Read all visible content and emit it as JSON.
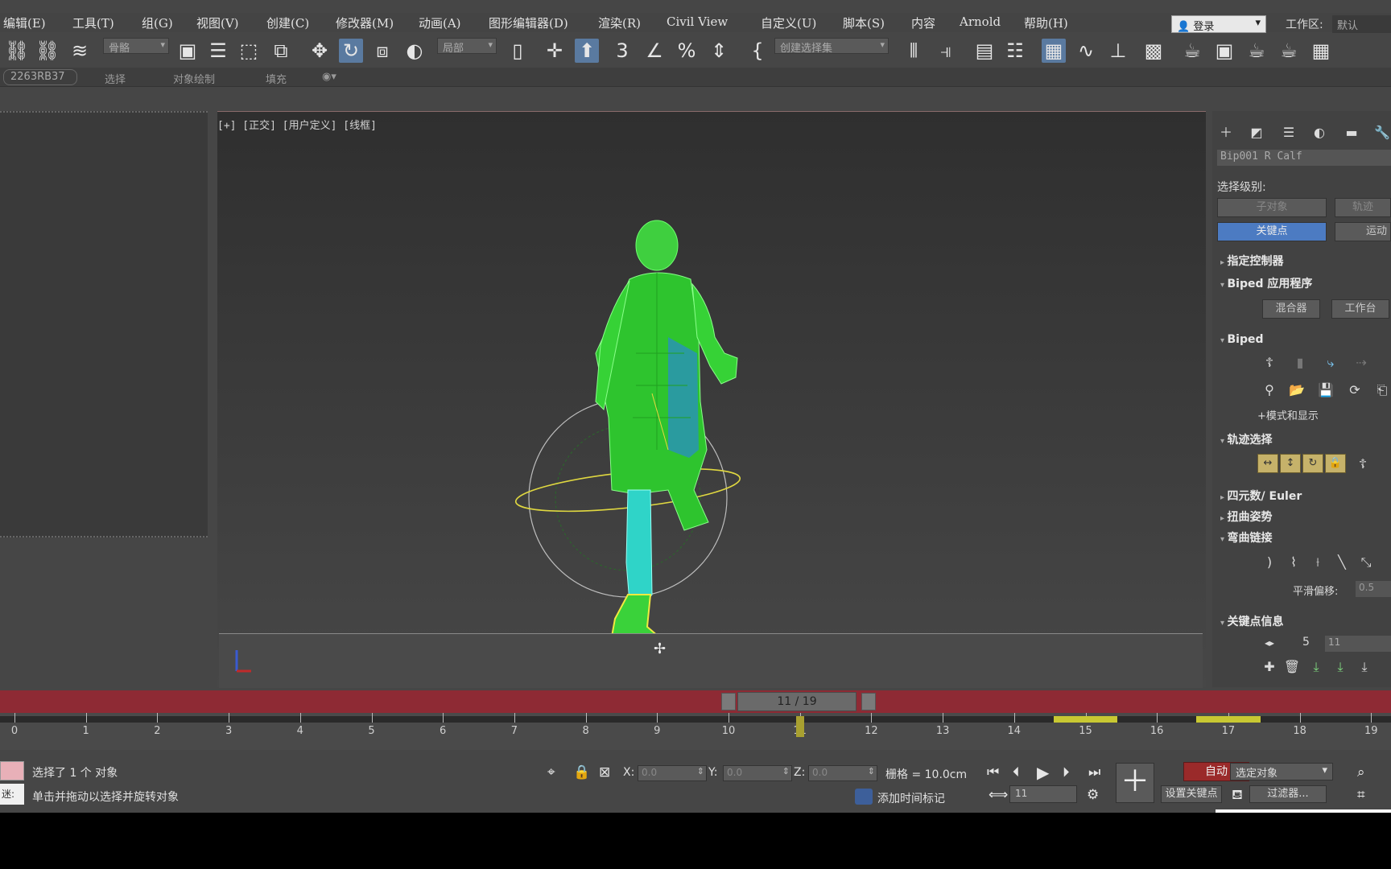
{
  "menu": [
    "编辑(E)",
    "工具(T)",
    "组(G)",
    "视图(V)",
    "创建(C)",
    "修改器(M)",
    "动画(A)",
    "图形编辑器(D)",
    "渲染(R)",
    "Civil View",
    "自定义(U)",
    "脚本(S)",
    "内容",
    "Arnold",
    "帮助(H)"
  ],
  "account": {
    "login": "登录",
    "workspace_label": "工作区:",
    "workspace_value": "默认"
  },
  "toolbar": {
    "filter_dropdown": "骨骼",
    "ref_coord_dropdown": "局部",
    "named_selection": "创建选择集"
  },
  "ribbon": {
    "active_tab": "2263RB37",
    "tabs": [
      "选择",
      "对象绘制",
      "填充"
    ]
  },
  "viewport": {
    "label": "[+] [正交] [用户定义] [线框]"
  },
  "command_panel": {
    "object_name": "Bip001 R Calf",
    "selection_level_label": "选择级别:",
    "sub_object_btn": "子对象",
    "track_btn": "轨迹",
    "keyframing_btn": "关键点",
    "motion_btn": "运动",
    "rollouts": {
      "assign_controller": "指定控制器",
      "biped_apps": "Biped 应用程序",
      "biped": "Biped",
      "track_selection": "轨迹选择",
      "quaternion": "四元数/ Euler",
      "twist_poses": "扭曲姿势",
      "bend_links": "弯曲链接",
      "key_info": "关键点信息"
    },
    "mixer_btn": "混合器",
    "workbench_btn": "工作台",
    "modes_display": "+模式和显示",
    "smooth_bias_label": "平滑偏移:",
    "smooth_bias_value": "0.5",
    "key_number": "5",
    "key_time": "11"
  },
  "timeline": {
    "frame_counter": "11 / 19",
    "ticks": [
      "0",
      "1",
      "2",
      "3",
      "4",
      "5",
      "6",
      "7",
      "8",
      "9",
      "10",
      "11",
      "12",
      "13",
      "14",
      "15",
      "16",
      "17",
      "18",
      "19"
    ],
    "current_frame": 11,
    "keys_yellow": [
      15,
      17
    ]
  },
  "status": {
    "selected_count": "选择了 1 个 对象",
    "prompt": "单击并拖动以选择并旋转对象",
    "maxscript_label": "迷:",
    "x_label": "X:",
    "x_value": "0.0",
    "y_label": "Y:",
    "y_value": "0.0",
    "z_label": "Z:",
    "z_value": "0.0",
    "grid": "栅格 = 10.0cm",
    "add_time_tag": "添加时间标记",
    "auto_key": "自动",
    "set_key": "设置关键点",
    "selected_obj": "选定对象",
    "filters": "过滤器...",
    "frame_field": "11"
  }
}
